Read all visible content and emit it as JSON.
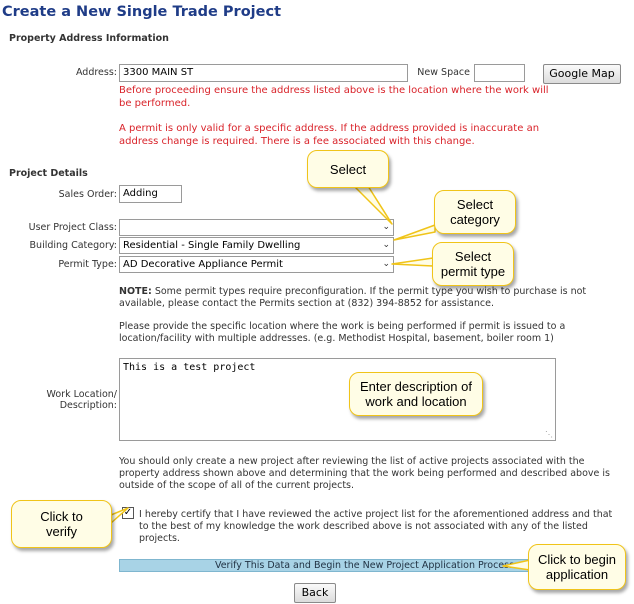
{
  "page": {
    "title": "Create a New Single Trade Project"
  },
  "property": {
    "heading": "Property Address Information",
    "address_label": "Address:",
    "address_value": "3300 MAIN ST",
    "new_space_label": "New Space",
    "new_space_value": "",
    "google_map_label": "Google Map",
    "warning_1": "Before proceeding ensure the address listed above is the location where the work will be performed.",
    "warning_2": "A permit is only valid for a specific address. If the address provided is inaccurate an address change is required. There is a fee associated with this change."
  },
  "project": {
    "heading": "Project Details",
    "sales_order_label": "Sales Order:",
    "sales_order_value": "Adding",
    "user_class_label": "User Project Class:",
    "user_class_value": "",
    "building_category_label": "Building Category:",
    "building_category_value": "Residential  - Single Family Dwelling",
    "permit_type_label": "Permit Type:",
    "permit_type_value": "AD Decorative Appliance Permit",
    "note_bold": "NOTE:",
    "note_text": " Some permit types require preconfiguration. If the permit type you wish to purchase is not available, please contact the Permits section at (832) 394-8852 for assistance.",
    "location_hint": "Please provide the specific location where the work is being performed if permit is issued to a location/facility with multiple addresses. (e.g. Methodist Hospital, basement, boiler room 1)",
    "work_location_label_1": "Work Location/",
    "work_location_label_2": "Description:",
    "work_location_value": "This is a test project",
    "review_text": "You should only create a new project after reviewing the list of active projects associated with the property address shown above and determining that the work being performed and described above is outside of the scope of all of the current projects.",
    "certify_checked": true,
    "certify_text": "I hereby certify that I have reviewed the active project list for the aforementioned address and that to the best of my knowledge the work described above is not associated with any of the listed projects.",
    "verify_label": "Verify This Data and Begin the New Project Application Process",
    "back_label": "Back"
  },
  "callouts": {
    "select": "Select",
    "select_category_1": "Select",
    "select_category_2": "category",
    "select_permit_1": "Select",
    "select_permit_2": "permit type",
    "enter_desc_1": "Enter description of",
    "enter_desc_2": "work and location",
    "click_verify_1": "Click to",
    "click_verify_2": "verify",
    "click_begin_1": "Click to begin",
    "click_begin_2": "application"
  },
  "icons": {
    "dropdown": "chevron-down-icon",
    "checkbox": "checkmark-icon",
    "resize": "resize-grip-icon"
  },
  "colors": {
    "title": "#1f3c87",
    "warning": "#d9232a",
    "verify_bar": "#a8d3e6",
    "callout_border": "#f0c419",
    "callout_fill": "#fffde6"
  }
}
